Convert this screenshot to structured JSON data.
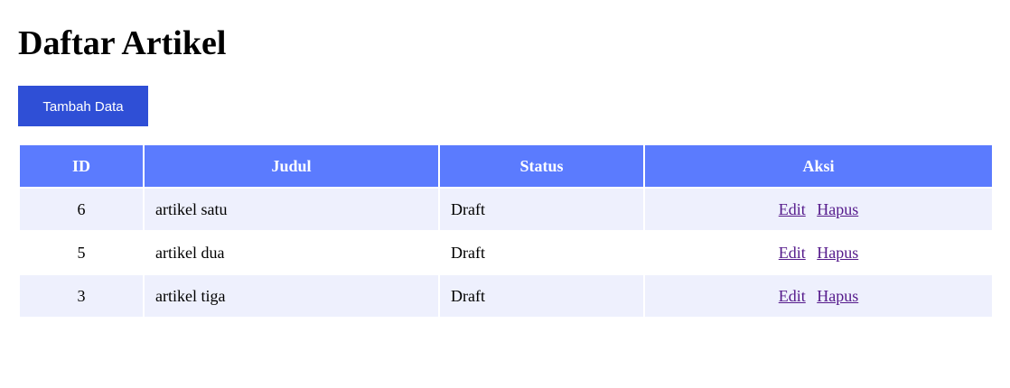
{
  "page": {
    "title": "Daftar Artikel"
  },
  "toolbar": {
    "add_label": "Tambah Data"
  },
  "table": {
    "headers": {
      "id": "ID",
      "judul": "Judul",
      "status": "Status",
      "aksi": "Aksi"
    },
    "rows": [
      {
        "id": "6",
        "judul": "artikel satu",
        "status": "Draft",
        "edit": "Edit",
        "hapus": "Hapus"
      },
      {
        "id": "5",
        "judul": "artikel dua",
        "status": "Draft",
        "edit": "Edit",
        "hapus": "Hapus"
      },
      {
        "id": "3",
        "judul": "artikel tiga",
        "status": "Draft",
        "edit": "Edit",
        "hapus": "Hapus"
      }
    ]
  },
  "colors": {
    "button": "#2f4fd6",
    "header": "#5b7bfe",
    "row_stripe": "#eef0fd",
    "link": "#551a8b"
  }
}
